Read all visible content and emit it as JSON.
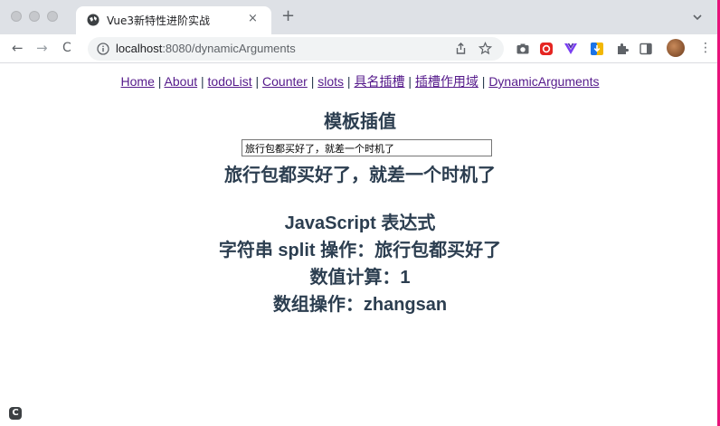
{
  "browser": {
    "tab_title": "Vue3新特性进阶实战",
    "tab_close": "×",
    "new_tab": "+",
    "url_host": "localhost",
    "url_rest": ":8080/dynamicArguments",
    "back": "←",
    "forward": "→",
    "reload": "C",
    "menu": "⋮",
    "accent_color": "#e8127a"
  },
  "nav": {
    "links": [
      "Home",
      "About",
      "todoList",
      "Counter",
      "slots",
      "具名插槽",
      "插槽作用域",
      "DynamicArguments"
    ],
    "separator": " | "
  },
  "content": {
    "section_title": "模板插值",
    "input_value": "旅行包都买好了，就差一个时机了",
    "echo_text": "旅行包都买好了，就差一个时机了",
    "js_title": "JavaScript 表达式",
    "split_line": "字符串 split 操作：旅行包都买好了",
    "calc_line": "数值计算：1",
    "array_line": "数组操作：zhangsan"
  },
  "extension_badge": "C"
}
